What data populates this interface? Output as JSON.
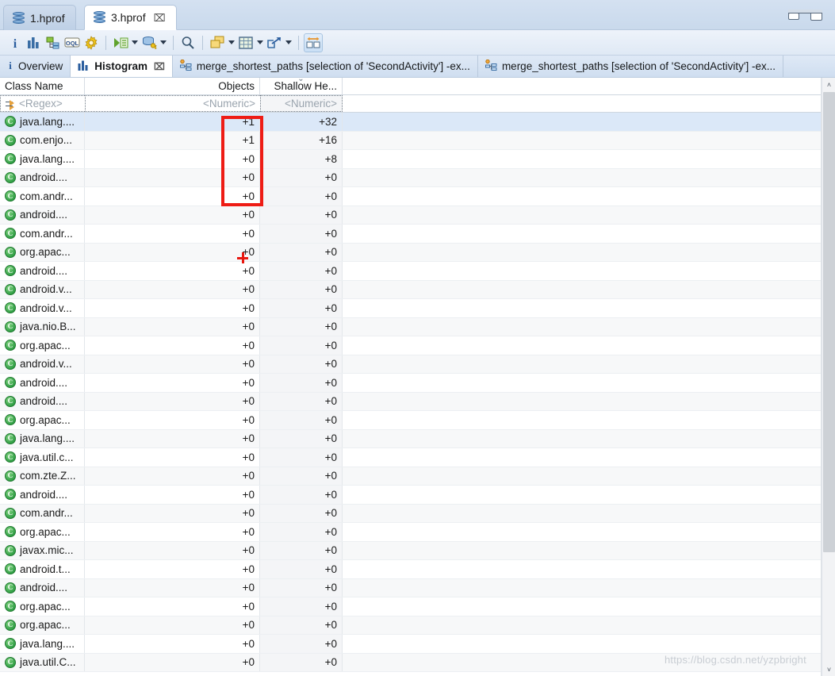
{
  "window": {
    "minimize_label": "Minimize",
    "maximize_label": "Maximize"
  },
  "editor_tabs": [
    {
      "label": "1.hprof",
      "icon": "heap-dump-icon",
      "active": false,
      "closable": false
    },
    {
      "label": "3.hprof",
      "icon": "heap-dump-icon",
      "active": true,
      "closable": true,
      "close_label": "⌧"
    }
  ],
  "toolbar": {
    "items": [
      {
        "name": "info-icon",
        "glyph": "i"
      },
      {
        "name": "histogram-icon",
        "glyph": "bars"
      },
      {
        "name": "dominator-tree-icon",
        "glyph": "tree"
      },
      {
        "name": "oql-icon",
        "glyph": "OQL"
      },
      {
        "name": "calculate-icon",
        "glyph": "gear"
      },
      {
        "name": "separator-1",
        "glyph": "sep"
      },
      {
        "name": "run-expert-system-icon",
        "glyph": "run-list"
      },
      {
        "name": "run-expert-system-dropdown",
        "glyph": "arrow"
      },
      {
        "name": "query-browser-icon",
        "glyph": "db-gear"
      },
      {
        "name": "query-browser-dropdown",
        "glyph": "arrow"
      },
      {
        "name": "separator-2",
        "glyph": "sep"
      },
      {
        "name": "find-icon",
        "glyph": "magnifier"
      },
      {
        "name": "separator-3",
        "glyph": "sep"
      },
      {
        "name": "group-by-icon",
        "glyph": "group"
      },
      {
        "name": "group-by-dropdown",
        "glyph": "arrow"
      },
      {
        "name": "calculator-icon",
        "glyph": "table"
      },
      {
        "name": "calculator-dropdown",
        "glyph": "arrow"
      },
      {
        "name": "export-icon",
        "glyph": "export"
      },
      {
        "name": "export-dropdown",
        "glyph": "arrow"
      },
      {
        "name": "separator-4",
        "glyph": "sep"
      },
      {
        "name": "compare-icon",
        "glyph": "compare",
        "framed": true
      }
    ]
  },
  "view_tabs": [
    {
      "label": "Overview",
      "icon": "info-icon",
      "active": false,
      "closable": false
    },
    {
      "label": "Histogram",
      "icon": "histogram-icon",
      "active": true,
      "closable": true,
      "close_label": "⌧"
    },
    {
      "label": "merge_shortest_paths [selection of 'SecondActivity'] -ex...",
      "icon": "merge-paths-icon",
      "active": false,
      "closable": false
    },
    {
      "label": "merge_shortest_paths [selection of 'SecondActivity'] -ex...",
      "icon": "merge-paths-icon",
      "active": false,
      "closable": false
    }
  ],
  "table": {
    "columns": [
      {
        "key": "class_name",
        "label": "Class Name",
        "align": "left",
        "sorted": false
      },
      {
        "key": "objects",
        "label": "Objects",
        "align": "right",
        "sorted": false
      },
      {
        "key": "shallow_heap",
        "label": "Shallow He...",
        "align": "right",
        "sorted": true,
        "sort_glyph": "⌄"
      }
    ],
    "filter_row": {
      "class_name_placeholder": "<Regex>",
      "objects_placeholder": "<Numeric>",
      "shallow_heap_placeholder": "<Numeric>"
    },
    "rows": [
      {
        "class_name": "java.lang....",
        "objects": "+1",
        "shallow_heap": "+32",
        "selected": true
      },
      {
        "class_name": "com.enjo...",
        "objects": "+1",
        "shallow_heap": "+16"
      },
      {
        "class_name": "java.lang....",
        "objects": "+0",
        "shallow_heap": "+8"
      },
      {
        "class_name": "android....",
        "objects": "+0",
        "shallow_heap": "+0"
      },
      {
        "class_name": "com.andr...",
        "objects": "+0",
        "shallow_heap": "+0"
      },
      {
        "class_name": "android....",
        "objects": "+0",
        "shallow_heap": "+0"
      },
      {
        "class_name": "com.andr...",
        "objects": "+0",
        "shallow_heap": "+0"
      },
      {
        "class_name": "org.apac...",
        "objects": "+0",
        "shallow_heap": "+0"
      },
      {
        "class_name": "android....",
        "objects": "+0",
        "shallow_heap": "+0"
      },
      {
        "class_name": "android.v...",
        "objects": "+0",
        "shallow_heap": "+0"
      },
      {
        "class_name": "android.v...",
        "objects": "+0",
        "shallow_heap": "+0"
      },
      {
        "class_name": "java.nio.B...",
        "objects": "+0",
        "shallow_heap": "+0"
      },
      {
        "class_name": "org.apac...",
        "objects": "+0",
        "shallow_heap": "+0"
      },
      {
        "class_name": "android.v...",
        "objects": "+0",
        "shallow_heap": "+0"
      },
      {
        "class_name": "android....",
        "objects": "+0",
        "shallow_heap": "+0"
      },
      {
        "class_name": "android....",
        "objects": "+0",
        "shallow_heap": "+0"
      },
      {
        "class_name": "org.apac...",
        "objects": "+0",
        "shallow_heap": "+0"
      },
      {
        "class_name": "java.lang....",
        "objects": "+0",
        "shallow_heap": "+0"
      },
      {
        "class_name": "java.util.c...",
        "objects": "+0",
        "shallow_heap": "+0"
      },
      {
        "class_name": "com.zte.Z...",
        "objects": "+0",
        "shallow_heap": "+0"
      },
      {
        "class_name": "android....",
        "objects": "+0",
        "shallow_heap": "+0"
      },
      {
        "class_name": "com.andr...",
        "objects": "+0",
        "shallow_heap": "+0"
      },
      {
        "class_name": "org.apac...",
        "objects": "+0",
        "shallow_heap": "+0"
      },
      {
        "class_name": "javax.mic...",
        "objects": "+0",
        "shallow_heap": "+0"
      },
      {
        "class_name": "android.t...",
        "objects": "+0",
        "shallow_heap": "+0"
      },
      {
        "class_name": "android....",
        "objects": "+0",
        "shallow_heap": "+0"
      },
      {
        "class_name": "org.apac...",
        "objects": "+0",
        "shallow_heap": "+0"
      },
      {
        "class_name": "org.apac...",
        "objects": "+0",
        "shallow_heap": "+0"
      },
      {
        "class_name": "java.lang....",
        "objects": "+0",
        "shallow_heap": "+0"
      },
      {
        "class_name": "java.util.C...",
        "objects": "+0",
        "shallow_heap": "+0"
      }
    ],
    "row_icon": "class-icon",
    "row_icon_glyph": "C"
  },
  "scrollbar": {
    "up_glyph": "˄",
    "down_glyph": "˅"
  },
  "annotations": {
    "highlight_box_color": "#ee1c15",
    "cursor_color": "#e8170f"
  },
  "watermark": "https://blog.csdn.net/yzpbright"
}
